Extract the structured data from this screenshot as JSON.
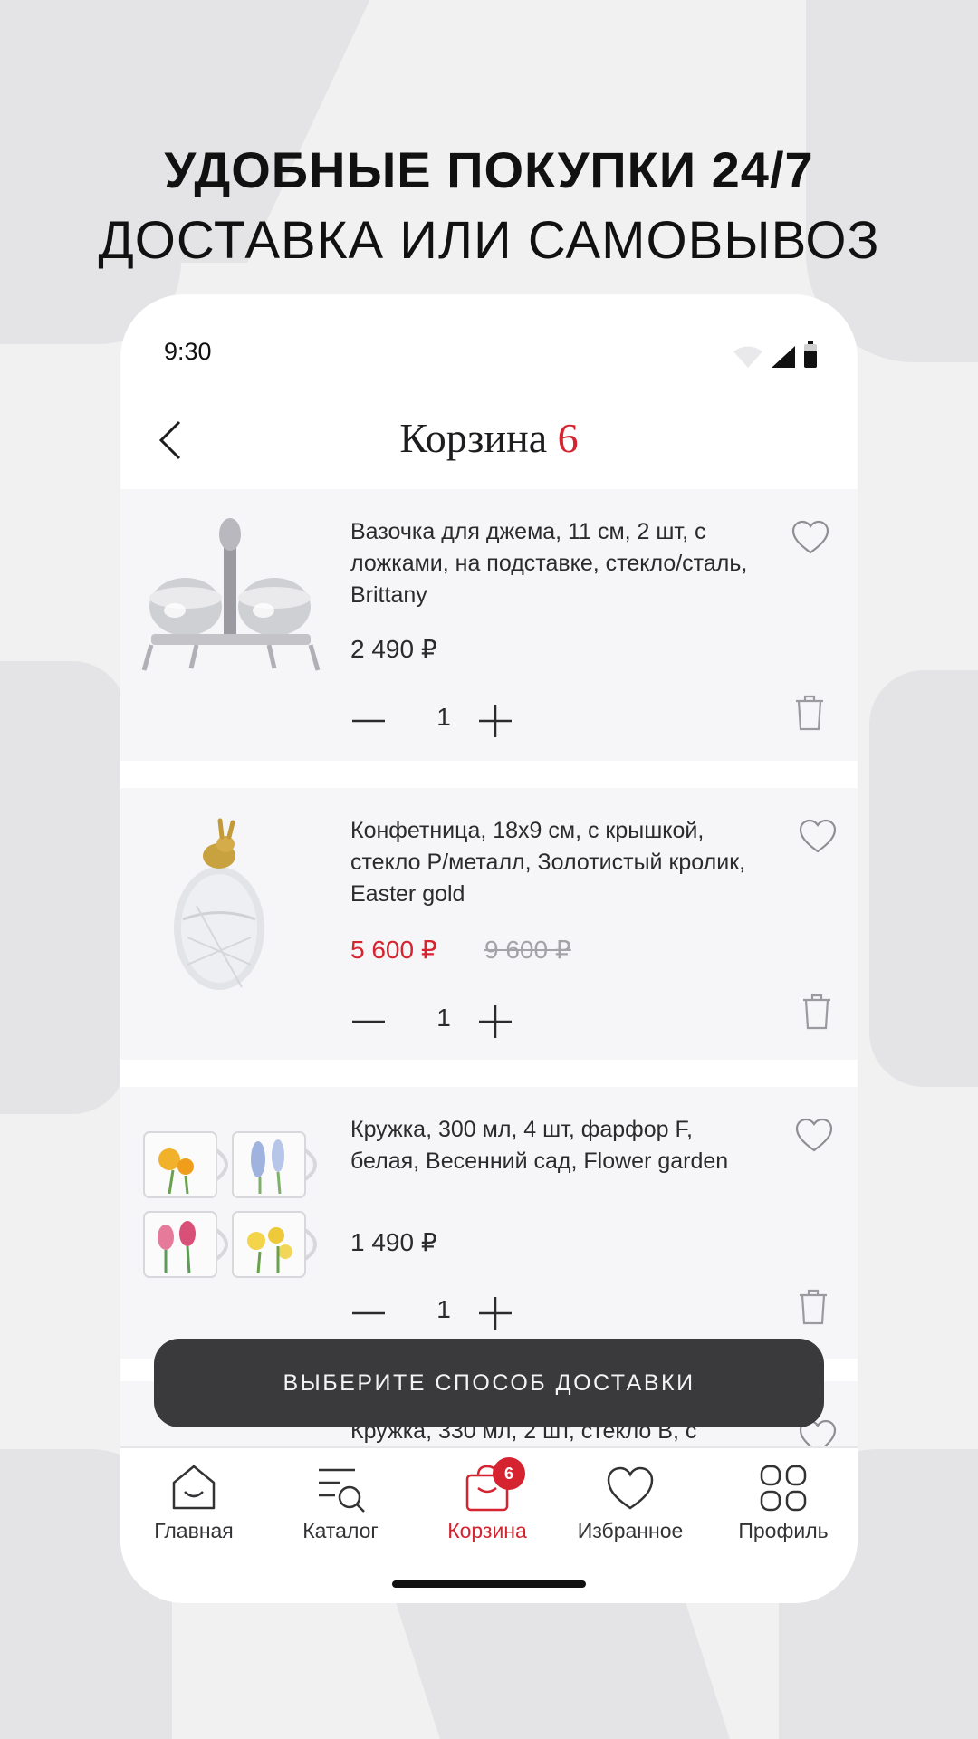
{
  "headline": {
    "line1": "УДОБНЫЕ ПОКУПКИ 24/7",
    "line2": "ДОСТАВКА ИЛИ САМОВЫВОЗ"
  },
  "status_bar": {
    "time": "9:30"
  },
  "nav": {
    "title": "Корзина",
    "count": "6"
  },
  "items": [
    {
      "name": "Вазочка для джема, 11 см, 2 шт, с ложками, на подставке, стекло/сталь, Brittany",
      "price": "2 490 ₽",
      "quantity": "1"
    },
    {
      "name": "Конфетница, 18х9 см, с крышкой, стекло Р/металл, Золотистый кролик, Easter gold",
      "price": "5 600 ₽",
      "old_price": "9 600 ₽",
      "quantity": "1"
    },
    {
      "name": "Кружка, 300 мл, 4 шт, фарфор F, белая, Весенний сад, Flower garden",
      "price": "1 490 ₽",
      "quantity": "1"
    },
    {
      "name": "Кружка, 330 мл, 2 шт, стекло В, с"
    }
  ],
  "cta": {
    "label": "ВЫБЕРИТЕ СПОСОБ ДОСТАВКИ"
  },
  "tabbar": {
    "tabs": [
      {
        "label": "Главная",
        "icon": "home-icon"
      },
      {
        "label": "Каталог",
        "icon": "catalog-search-icon"
      },
      {
        "label": "Корзина",
        "icon": "cart-bag-icon",
        "badge": "6",
        "active": true
      },
      {
        "label": "Избранное",
        "icon": "heart-icon"
      },
      {
        "label": "Профиль",
        "icon": "grid-icon"
      }
    ]
  },
  "colors": {
    "accent": "#d5232f",
    "button": "#3a3a3c",
    "card": "#f6f6f8",
    "background": "#f1f1f2"
  }
}
